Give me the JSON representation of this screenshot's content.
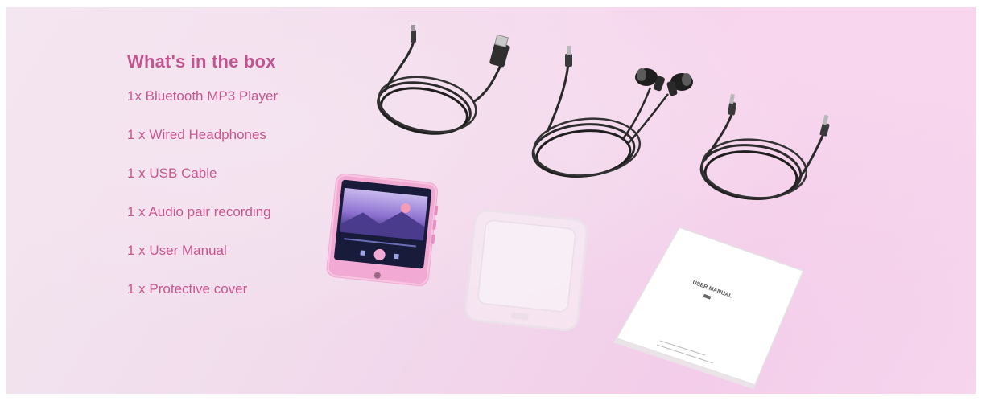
{
  "title": "What's in the box",
  "items": [
    "1x Bluetooth MP3 Player",
    "1 x Wired Headphones",
    "1 x USB Cable",
    "1 x Audio pair recording",
    "1 x User Manual",
    "1 x Protective cover"
  ],
  "manual_cover_text": "USER MANUAL",
  "colors": {
    "accent": "#c0558f",
    "player_body": "#f2a9d3",
    "cable": "#2a2a2a"
  }
}
